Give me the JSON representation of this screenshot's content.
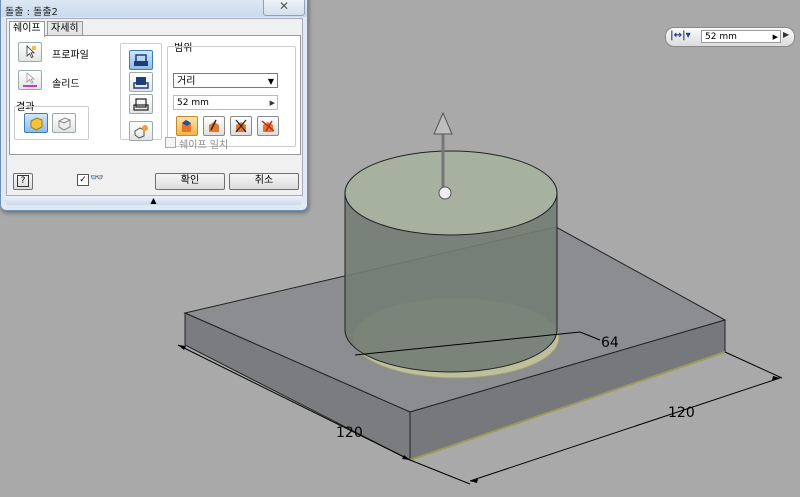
{
  "dialog": {
    "title": "돌출 : 돌출2",
    "close_glyph": "✕",
    "tabs": [
      "쉐이프",
      "자세히"
    ],
    "shape": {
      "profile_label": "프로파일",
      "solid_label": "솔리드",
      "result_label": "결과"
    },
    "extents": {
      "label": "범위",
      "type_value": "거리",
      "distance_value": "52 mm",
      "match_shape_label": "쉐이프 일치"
    },
    "buttons": {
      "ok": "확인",
      "cancel": "취소",
      "help": "?"
    }
  },
  "minitoolbar": {
    "distance_value": "52 mm"
  },
  "dimensions": {
    "diameter": "64",
    "width": "120",
    "depth": "120"
  }
}
